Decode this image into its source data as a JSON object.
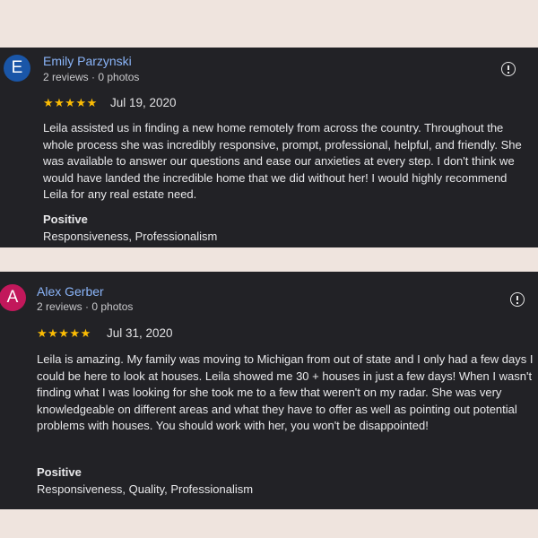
{
  "reviews": [
    {
      "avatar_letter": "E",
      "avatar_color": "#1a56a8",
      "reviewer_name": "Emily Parzynski",
      "reviewer_meta": "2 reviews · 0 photos",
      "stars": "★★★★★",
      "rating": 5,
      "date": "Jul 19, 2020",
      "text": "Leila assisted us in finding a new home remotely from across the country. Throughout the whole process she was incredibly responsive, prompt, professional, helpful, and friendly. She was available to answer our questions and ease our anxieties at every step. I don't think we would have landed the incredible home that we did without her! I would highly recommend Leila for any real estate need.",
      "category_heading": "Positive",
      "category_values": "Responsiveness, Professionalism"
    },
    {
      "avatar_letter": "A",
      "avatar_color": "#c2185b",
      "reviewer_name": "Alex Gerber",
      "reviewer_meta": "2 reviews · 0 photos",
      "stars": "★★★★★",
      "rating": 5,
      "date": "Jul 31, 2020",
      "text": "Leila is amazing. My family was moving to Michigan from out of state and I only had a few days I could be here to look at houses. Leila showed me 30 + houses in just a few days! When I wasn't finding what I was looking for she took me to a few that weren't on my radar. She was very knowledgeable on different areas and what they have to offer as well as pointing out potential problems with houses. You should work with her, you won't be disappointed!",
      "category_heading": "Positive",
      "category_values": "Responsiveness, Quality, Professionalism"
    }
  ],
  "colors": {
    "background": "#efe4de",
    "card": "#222226",
    "name_link": "#8ab4f8",
    "star": "#fbbc04"
  },
  "icons": {
    "report": "report-icon",
    "star": "star-icon"
  }
}
